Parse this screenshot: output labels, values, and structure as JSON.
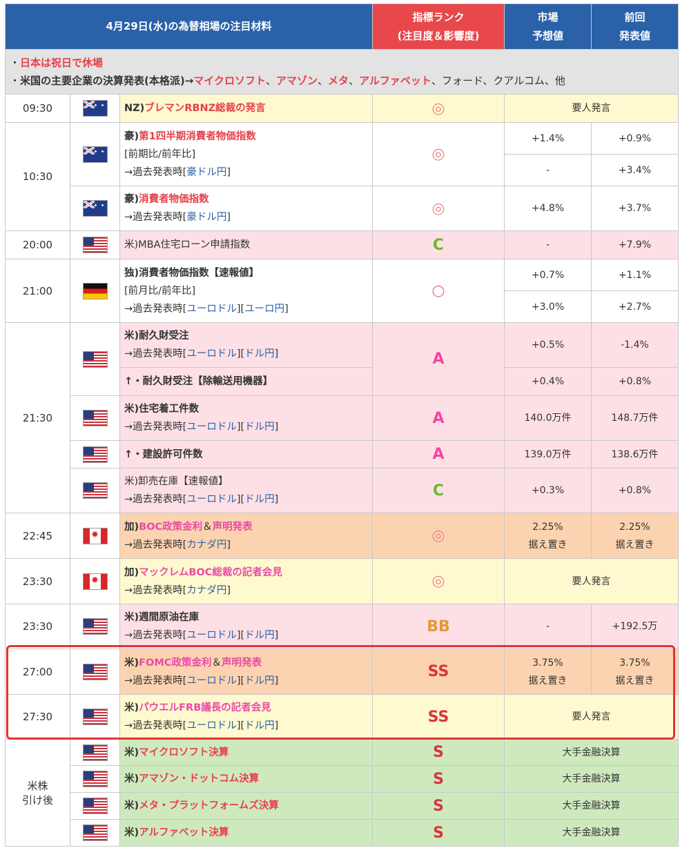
{
  "header": {
    "title": "4月29日(水)の為替相場の注目材料",
    "rank_line1": "指標ランク",
    "rank_line2": "(注目度＆影響度)",
    "forecast_line1": "市場",
    "forecast_line2": "予想値",
    "previous_line1": "前回",
    "previous_line2": "発表値"
  },
  "notes": {
    "bullet": "・",
    "holiday": "日本は祝日で休場",
    "earnings_prefix": "米国の主要企業の決算発表(本格派)→",
    "c1": "マイクロソフト",
    "c2": "アマゾン",
    "c3": "メタ",
    "c4": "アルファベット",
    "sep": "、",
    "rest": "フォード、クアルコム、他"
  },
  "common": {
    "arrow_prefix": "→過去発表時",
    "lb": "[",
    "rb": "]",
    "aud_jpy": "豪ドル円",
    "eur_usd": "ユーロドル",
    "eur_jpy": "ユーロ円",
    "usd_jpy": "ドル円",
    "cad_jpy": "カナダ円"
  },
  "rows": {
    "r1": {
      "time": "09:30",
      "flag": "nz-flag-icon",
      "country": "NZ)",
      "name": "ブレマンRBNZ総裁の発言",
      "rank": "◎",
      "merged": "要人発言"
    },
    "r2": {
      "time": "10:30",
      "flag": "australia-flag-icon",
      "country": "豪)",
      "name": "第1四半期消費者物価指数",
      "sub": "[前期比/前年比]",
      "rank": "◎",
      "f1": "+1.4%",
      "p1": "+0.9%",
      "f2": "-",
      "p2": "+3.4%"
    },
    "r3": {
      "flag": "australia-flag-icon",
      "country": "豪)",
      "name": "消費者物価指数",
      "rank": "◎",
      "f": "+4.8%",
      "p": "+3.7%"
    },
    "r4": {
      "time": "20:00",
      "flag": "us-flag-icon",
      "name": "米)MBA住宅ローン申請指数",
      "rank": "C",
      "f": "-",
      "p": "+7.9%"
    },
    "r5": {
      "time": "21:00",
      "flag": "germany-flag-icon",
      "name": "独)消費者物価指数【速報値】",
      "sub": "[前月比/前年比]",
      "rank": "○",
      "f1": "+0.7%",
      "p1": "+1.1%",
      "f2": "+3.0%",
      "p2": "+2.7%"
    },
    "r6": {
      "time": "21:30",
      "flag": "us-flag-icon",
      "name": "米)耐久財受注",
      "rank": "A",
      "f": "+0.5%",
      "p": "-1.4%"
    },
    "r6b": {
      "name": "↑・耐久財受注【除輸送用機器】",
      "f": "+0.4%",
      "p": "+0.8%"
    },
    "r7": {
      "flag": "us-flag-icon",
      "name": "米)住宅着工件数",
      "rank": "A",
      "f": "140.0万件",
      "p": "148.7万件"
    },
    "r8": {
      "flag": "us-flag-icon",
      "name": "↑・建設許可件数",
      "rank": "A",
      "f": "139.0万件",
      "p": "138.6万件"
    },
    "r9": {
      "flag": "us-flag-icon",
      "name": "米)卸売在庫【速報値】",
      "rank": "C",
      "f": "+0.3%",
      "p": "+0.8%"
    },
    "r10": {
      "time": "22:45",
      "flag": "canada-flag-icon",
      "country": "加)",
      "name1": "BOC政策金利",
      "amp": "＆",
      "name2": "声明発表",
      "rank": "◎",
      "f1": "2.25%",
      "f2": "据え置き",
      "p1": "2.25%",
      "p2": "据え置き"
    },
    "r11": {
      "time": "23:30",
      "flag": "canada-flag-icon",
      "country": "加)",
      "name": "マックレムBOC総裁の記者会見",
      "rank": "◎",
      "merged": "要人発言"
    },
    "r12": {
      "time": "23:30",
      "flag": "us-flag-icon",
      "name": "米)週間原油在庫",
      "rank": "BB",
      "f": "-",
      "p": "+192.5万"
    },
    "r13": {
      "time": "27:00",
      "flag": "us-flag-icon",
      "country": "米)",
      "name1": "FOMC政策金利",
      "amp": "＆",
      "name2": "声明発表",
      "rank": "SS",
      "f1": "3.75%",
      "f2": "据え置き",
      "p1": "3.75%",
      "p2": "据え置き"
    },
    "r14": {
      "time": "27:30",
      "flag": "us-flag-icon",
      "country": "米)",
      "name": "パウエルFRB議長の記者会見",
      "rank": "SS",
      "merged": "要人発言"
    },
    "after": {
      "time1": "米株",
      "time2": "引け後"
    },
    "r15": {
      "flag": "us-flag-icon",
      "country": "米)",
      "name": "マイクロソフト決算",
      "rank": "S",
      "merged": "大手金融決算"
    },
    "r16": {
      "flag": "us-flag-icon",
      "country": "米)",
      "name": "アマゾン・ドットコム決算",
      "rank": "S",
      "merged": "大手金融決算"
    },
    "r17": {
      "flag": "us-flag-icon",
      "country": "米)",
      "name": "メタ・プラットフォームズ決算",
      "rank": "S",
      "merged": "大手金融決算"
    },
    "r18": {
      "flag": "us-flag-icon",
      "country": "米)",
      "name": "アルファベット決算",
      "rank": "S",
      "merged": "大手金融決算"
    }
  },
  "colors": {
    "header_blue": "#2a61a8",
    "header_red": "#e8484b",
    "highlight_border": "#e23333",
    "row_yellow": "#fff9cf",
    "row_pink": "#fde0e6",
    "row_orange": "#fcd3b0",
    "row_green": "#cfe9be"
  }
}
